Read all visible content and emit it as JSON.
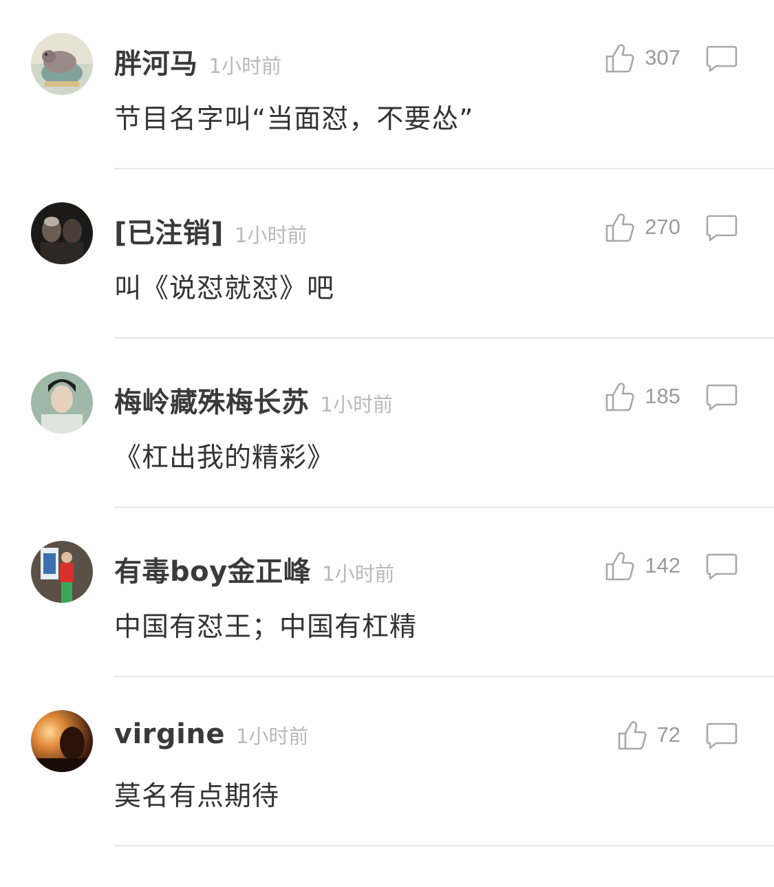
{
  "comments": [
    {
      "username": "胖河马",
      "time": "1小时前",
      "likes": "307",
      "text": "节目名字叫“当面怼，不要怂”",
      "avatar": "hippo-avatar"
    },
    {
      "username": "[已注销]",
      "time": "1小时前",
      "likes": "270",
      "text": "叫《说怼就怼》吧",
      "avatar": "dark-portrait-avatar"
    },
    {
      "username": "梅岭藏殊梅长苏",
      "time": "1小时前",
      "likes": "185",
      "text": "《杠出我的精彩》",
      "avatar": "costume-portrait-avatar"
    },
    {
      "username": "有毒boy金正峰",
      "time": "1小时前",
      "likes": "142",
      "text": "中国有怼王；中国有杠精",
      "avatar": "red-shirt-avatar"
    },
    {
      "username": "virgine",
      "time": "1小时前",
      "likes": "72",
      "text": "莫名有点期待",
      "avatar": "sunset-avatar"
    }
  ]
}
